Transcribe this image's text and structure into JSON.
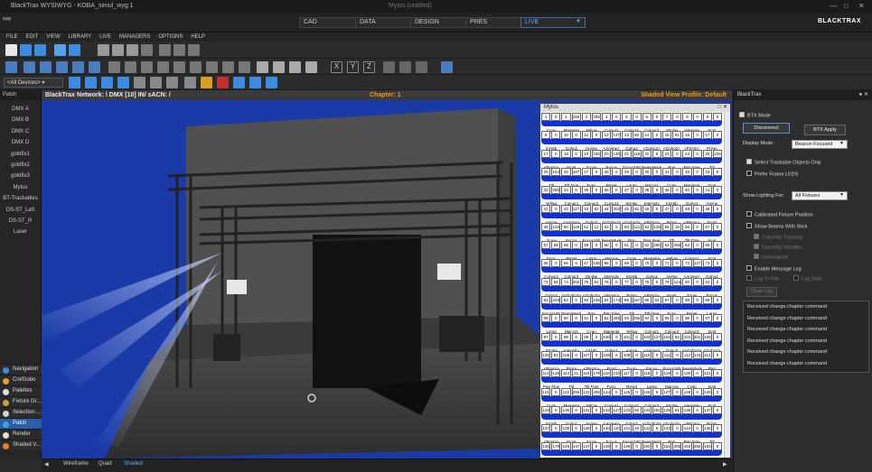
{
  "window": {
    "title": "BlackTrax WYSIWYG - KOBA_simul_wyg:1",
    "center_caption": "Mytos (untitled)",
    "logo": "wyg"
  },
  "modes": [
    {
      "label": "CAD",
      "active": false
    },
    {
      "label": "DATA",
      "active": false
    },
    {
      "label": "DESIGN",
      "active": false
    },
    {
      "label": "PRES",
      "active": false
    },
    {
      "label": "LIVE",
      "active": true
    }
  ],
  "brand": "BLACKTRAX",
  "menu": [
    "FILE",
    "EDIT",
    "VIEW",
    "LIBRARY",
    "LIVE",
    "MANAGERS",
    "OPTIONS",
    "HELP"
  ],
  "device_filter": "<All Devices>",
  "patch_panel": {
    "title": "Patch",
    "items": [
      "DMX A",
      "DMX B",
      "DMX C",
      "DMX D",
      "goldfix1",
      "goldfix2",
      "goldfix3",
      "Mytos",
      "BT-Trackables",
      "DS-ST_Left",
      "DS-ST_R",
      "Laser"
    ]
  },
  "left_tools": [
    {
      "label": "Navigation",
      "color": "#3b8be0",
      "active": false
    },
    {
      "label": "Col/Gobo",
      "color": "#e0a030",
      "active": false
    },
    {
      "label": "Palettes",
      "color": "#e0e0e0",
      "active": false
    },
    {
      "label": "Fixture Gr...",
      "color": "#c8a040",
      "active": false
    },
    {
      "label": "Selection ...",
      "color": "#d0d0d0",
      "active": false
    },
    {
      "label": "Patch",
      "color": "#40a0e0",
      "active": true
    },
    {
      "label": "Render",
      "color": "#e0e0e0",
      "active": false
    },
    {
      "label": "Shaded V...",
      "color": "#e08030",
      "active": false
    }
  ],
  "viewport": {
    "network": "BlackTrax Network: \\ DMX [10] IN/ sACN: /",
    "chapter": "Chapter: 1",
    "profile": "Shaded View Profile: Default"
  },
  "view_tabs": [
    {
      "label": "Wireframe",
      "active": false
    },
    {
      "label": "Quad",
      "active": false
    },
    {
      "label": "Shaded",
      "active": true
    }
  ],
  "mytos": {
    "title": "Mytos",
    "rows": [
      {
        "cells": [
          "1",
          "0",
          "2",
          "255",
          "3",
          "255",
          "4",
          "0",
          "5",
          "0",
          "6",
          "0",
          "7",
          "0",
          "8",
          "0",
          "9",
          "0"
        ],
        "labels": [
          "Cyan",
          "Magenta",
          "Yellow",
          "Colour1",
          "Colour2",
          "Colour3",
          "Strobe",
          "Intensity",
          "Spot"
        ]
      },
      {
        "cells": [
          "9",
          "0",
          "10",
          "0",
          "11",
          "0",
          "12",
          "127",
          "13",
          "82",
          "14",
          "0",
          "15",
          "81",
          "16",
          "0",
          "17",
          "0"
        ],
        "labels": [
          "Int16b",
          "Gobo1",
          "Anime",
          "<Anime>",
          "Gobo2",
          "<Gobo2>",
          "<Gobo2>",
          "<Prism>",
          "Prism"
        ]
      },
      {
        "cells": [
          "17",
          "0",
          "18",
          "0",
          "19",
          "106",
          "20",
          "130",
          "21",
          "118",
          "22",
          "0",
          "23",
          "0",
          "24",
          "0",
          "25",
          "226"
        ],
        "labels": [
          "<Prism>",
          "Frost",
          "Zoom",
          "Focus",
          "Focus16b",
          "BeamMode",
          "Pan",
          "Pan Fine",
          "Tilt"
        ]
      },
      {
        "cells": [
          "25",
          "164",
          "26",
          "187",
          "27",
          "0",
          "28",
          "0",
          "29",
          "0",
          "30",
          "0",
          "31",
          "0",
          "32",
          "0",
          "33",
          "0"
        ],
        "labels": [
          "Tilt",
          "Tilt Fine",
          "Func",
          "Reset",
          "Lamp",
          "Macros",
          "Cyan",
          "Magenta",
          "Spot"
        ]
      },
      {
        "cells": [
          "33",
          "255",
          "34",
          "0",
          "35",
          "0",
          "36",
          "0",
          "37",
          "0",
          "38",
          "0",
          "39",
          "0",
          "40",
          "0",
          "41",
          "0"
        ],
        "labels": [
          "Yellow",
          "Colour1",
          "Colour2",
          "Colour3",
          "Strobe",
          "Intensity",
          "Int16b",
          "Gobo1",
          "Anime"
        ]
      },
      {
        "cells": [
          "41",
          "0",
          "42",
          "127",
          "43",
          "82",
          "44",
          "202",
          "45",
          "81",
          "46",
          "0",
          "47",
          "0",
          "48",
          "0",
          "49",
          "0"
        ],
        "labels": [
          "Anime",
          "<Anime>",
          "Gobo2",
          "<<Gobo2>",
          "<Gobo2>",
          "<Prism>",
          "Prism",
          "<Prism>",
          "Frost"
        ]
      },
      {
        "cells": [
          "49",
          "126",
          "50",
          "129",
          "51",
          "12",
          "52",
          "0",
          "53",
          "121",
          "54",
          "128",
          "55",
          "18",
          "56",
          "0",
          "57",
          "0"
        ],
        "labels": [
          "Zoom",
          "Focus",
          "Focus16b",
          "BeamMode",
          "Pan",
          "Pan Fine",
          "Tilt",
          "Tilt Fine",
          "Spot"
        ]
      },
      {
        "cells": [
          "57",
          "58",
          "58",
          "0",
          "59",
          "0",
          "60",
          "0",
          "61",
          "0",
          "62",
          "255",
          "63",
          "255",
          "64",
          "0",
          "65",
          "0"
        ],
        "labels": [
          "Func",
          "Reset",
          "Lamp",
          "Macros",
          "Cyan",
          "Magenta",
          "Yellow",
          "Colour1",
          "Spot"
        ]
      },
      {
        "cells": [
          "65",
          "0",
          "66",
          "0",
          "67",
          "106",
          "68",
          "0",
          "69",
          "0",
          "70",
          "0",
          "71",
          "0",
          "72",
          "127",
          "73",
          "0"
        ],
        "labels": [
          "Colour2",
          "Colour3",
          "Strobe",
          "Intensity",
          "Int16b",
          "Gobo1",
          "Anime",
          "<Anime>",
          "Gobo2"
        ]
      },
      {
        "cells": [
          "73",
          "82",
          "74",
          "202",
          "75",
          "81",
          "76",
          "0",
          "77",
          "0",
          "78",
          "0",
          "79",
          "144",
          "80",
          "0",
          "81",
          "0"
        ],
        "labels": [
          "Gobo2",
          "<<Gobo2>",
          "<Gobo2>",
          "<Prism>",
          "Prism",
          "<Prism>",
          "Frost",
          "Zoom",
          "Focus"
        ]
      },
      {
        "cells": [
          "81",
          "228",
          "82",
          "0",
          "83",
          "136",
          "84",
          "174",
          "85",
          "157",
          "86",
          "63",
          "87",
          "0",
          "88",
          "0",
          "89",
          "0"
        ],
        "labels": [
          "Focus16b",
          "BeamMode",
          "Pan",
          "Pan Fine",
          "Tilt",
          "Tilt Fine",
          "Func",
          "Reset",
          "Lamp"
        ]
      },
      {
        "cells": [
          "89",
          "0",
          "90",
          "0",
          "91",
          "0",
          "92",
          "255",
          "93",
          "255",
          "94",
          "0",
          "95",
          "0",
          "96",
          "0",
          "97",
          "0"
        ],
        "labels": [
          "Lamp",
          "Macros",
          "Cyan",
          "Magenta",
          "Yellow",
          "Colour1",
          "Colour2",
          "Colour3",
          "Spot"
        ]
      },
      {
        "cells": [
          "97",
          "0",
          "98",
          "0",
          "99",
          "0",
          "100",
          "0",
          "101",
          "0",
          "102",
          "127",
          "103",
          "82",
          "104",
          "202",
          "105",
          "0"
        ],
        "labels": [
          "Strobe",
          "Intensity",
          "Int16b",
          "Gobo1",
          "Anime",
          "<Anime>",
          "Gobo2",
          "<<Gobo2>",
          "<Gobo2>"
        ]
      },
      {
        "cells": [
          "105",
          "81",
          "106",
          "0",
          "107",
          "0",
          "108",
          "0",
          "109",
          "0",
          "110",
          "0",
          "111",
          "0",
          "112",
          "143",
          "113",
          "0"
        ],
        "labels": [
          "<Prism>",
          "Prism",
          "<Prism>",
          "Frost",
          "Zoom",
          "Focus",
          "Focus16b",
          "BeamMode",
          "Pan"
        ]
      },
      {
        "cells": [
          "113",
          "128",
          "114",
          "21",
          "115",
          "179",
          "116",
          "232",
          "117",
          "0",
          "118",
          "0",
          "119",
          "0",
          "120",
          "0",
          "121",
          "0"
        ],
        "labels": [
          "Pan Fine",
          "Tilt",
          "Tilt Fine",
          "Func",
          "Reset",
          "Lamp",
          "Macros",
          "Cyan",
          "Spot"
        ]
      },
      {
        "cells": [
          "121",
          "0",
          "122",
          "255",
          "123",
          "255",
          "124",
          "0",
          "125",
          "0",
          "126",
          "0",
          "127",
          "0",
          "128",
          "0",
          "129",
          "0"
        ],
        "labels": [
          "Cyan",
          "Magenta",
          "Yellow",
          "Colour1",
          "Colour2",
          "Colour3",
          "Strobe",
          "Intensity",
          "Spot"
        ]
      },
      {
        "cells": [
          "129",
          "0",
          "130",
          "0",
          "131",
          "0",
          "132",
          "127",
          "133",
          "82",
          "134",
          "202",
          "135",
          "81",
          "136",
          "0",
          "137",
          "0"
        ],
        "labels": [
          "Int16b",
          "Gobo1",
          "Anime",
          "<Anime>",
          "Gobo2",
          "<<Gobo2>",
          "<Gobo2>",
          "<Prism>",
          "Prism"
        ]
      },
      {
        "cells": [
          "137",
          "0",
          "138",
          "0",
          "139",
          "0",
          "140",
          "110",
          "141",
          "20",
          "142",
          "0",
          "143",
          "0",
          "144",
          "0",
          "145",
          "0"
        ],
        "labels": [
          "<Prism>",
          "Frost",
          "Zoom",
          "Focus",
          "Focus16b",
          "BeamMode",
          "Pan",
          "Pan Fine",
          "Tilt"
        ]
      },
      {
        "cells": [
          "145",
          "179",
          "146",
          "147",
          "147",
          "0",
          "148",
          "0",
          "149",
          "0",
          "150",
          "0",
          "151",
          "255",
          "152",
          "255",
          "153",
          "0"
        ],
        "labels": [
          "Tilt",
          "Tilt Fine",
          "Func",
          "Reset",
          "Lamp",
          "Macros",
          "Cyan",
          "Magenta",
          "Spot"
        ]
      }
    ]
  },
  "blacktrax_panel": {
    "title": "BlackTrax",
    "btx_mode": "BTX Mode",
    "disconnect": "Disconnect",
    "apply": "BTX Apply",
    "display_mode_label": "Display Mode:",
    "display_mode_value": "Beacon Focused",
    "select_trackable": "Select Trackable Objects Only",
    "prefer_frame": "Prefer Frame LEDS",
    "show_lighting_label": "Show Lighting For:",
    "show_lighting_value": "All Fixtures",
    "calibrated": "Calibrated Fixture Position",
    "show_beams": "Show Beams With Stick",
    "currently_tracking": "Currently Tracking",
    "currently_standby": "Currently Standby",
    "unassigned": "Unassigned",
    "enable_log": "Enable Message Log",
    "log_to_file": "Log To File",
    "log_data": "Log Data",
    "clear_log": "Clear Log",
    "messages": [
      "Received change chapter command",
      "Received change chapter command",
      "Received change chapter command",
      "Received change chapter command",
      "Received change chapter command",
      "Received change chapter command"
    ]
  }
}
